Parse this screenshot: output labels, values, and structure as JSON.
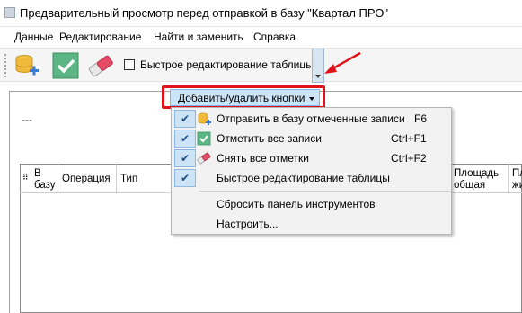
{
  "window": {
    "title": "Предварительный просмотр перед отправкой в базу \"Квартал ПРО\""
  },
  "menu": {
    "items": [
      "Данные",
      "Редактирование",
      "Найти и заменить",
      "Справка"
    ]
  },
  "toolbar": {
    "send_icon": "database-add-icon",
    "check_icon": "check-mark-icon",
    "eraser_icon": "eraser-icon",
    "quick_edit_label": "Быстрое редактирование таблицы",
    "quick_edit_checked": false
  },
  "content": {
    "dash": "---",
    "columns": [
      {
        "label": "В\nбазу"
      },
      {
        "label": "Операция"
      },
      {
        "label": "Тип"
      },
      {
        "label": "Площадь\nобщая"
      },
      {
        "label": "Пл\nжи"
      }
    ]
  },
  "dropdown": {
    "label": "Добавить/удалить кнопки"
  },
  "popup": {
    "items": [
      {
        "label": "Отправить в базу отмеченные записи",
        "shortcut": "F6",
        "checked": true,
        "icon": "database-add-icon"
      },
      {
        "label": "Отметить все записи",
        "shortcut": "Ctrl+F1",
        "checked": true,
        "icon": "check-mark-icon"
      },
      {
        "label": "Снять все отметки",
        "shortcut": "Ctrl+F2",
        "checked": true,
        "icon": "eraser-icon"
      },
      {
        "label": "Быстрое редактирование таблицы",
        "shortcut": "",
        "checked": true,
        "icon": ""
      }
    ],
    "reset_label": "Сбросить панель инструментов",
    "customize_label": "Настроить..."
  },
  "colors": {
    "highlight_red": "#e0121c",
    "selection_blue": "#cce4f7",
    "check_green": "#4caf7a"
  }
}
